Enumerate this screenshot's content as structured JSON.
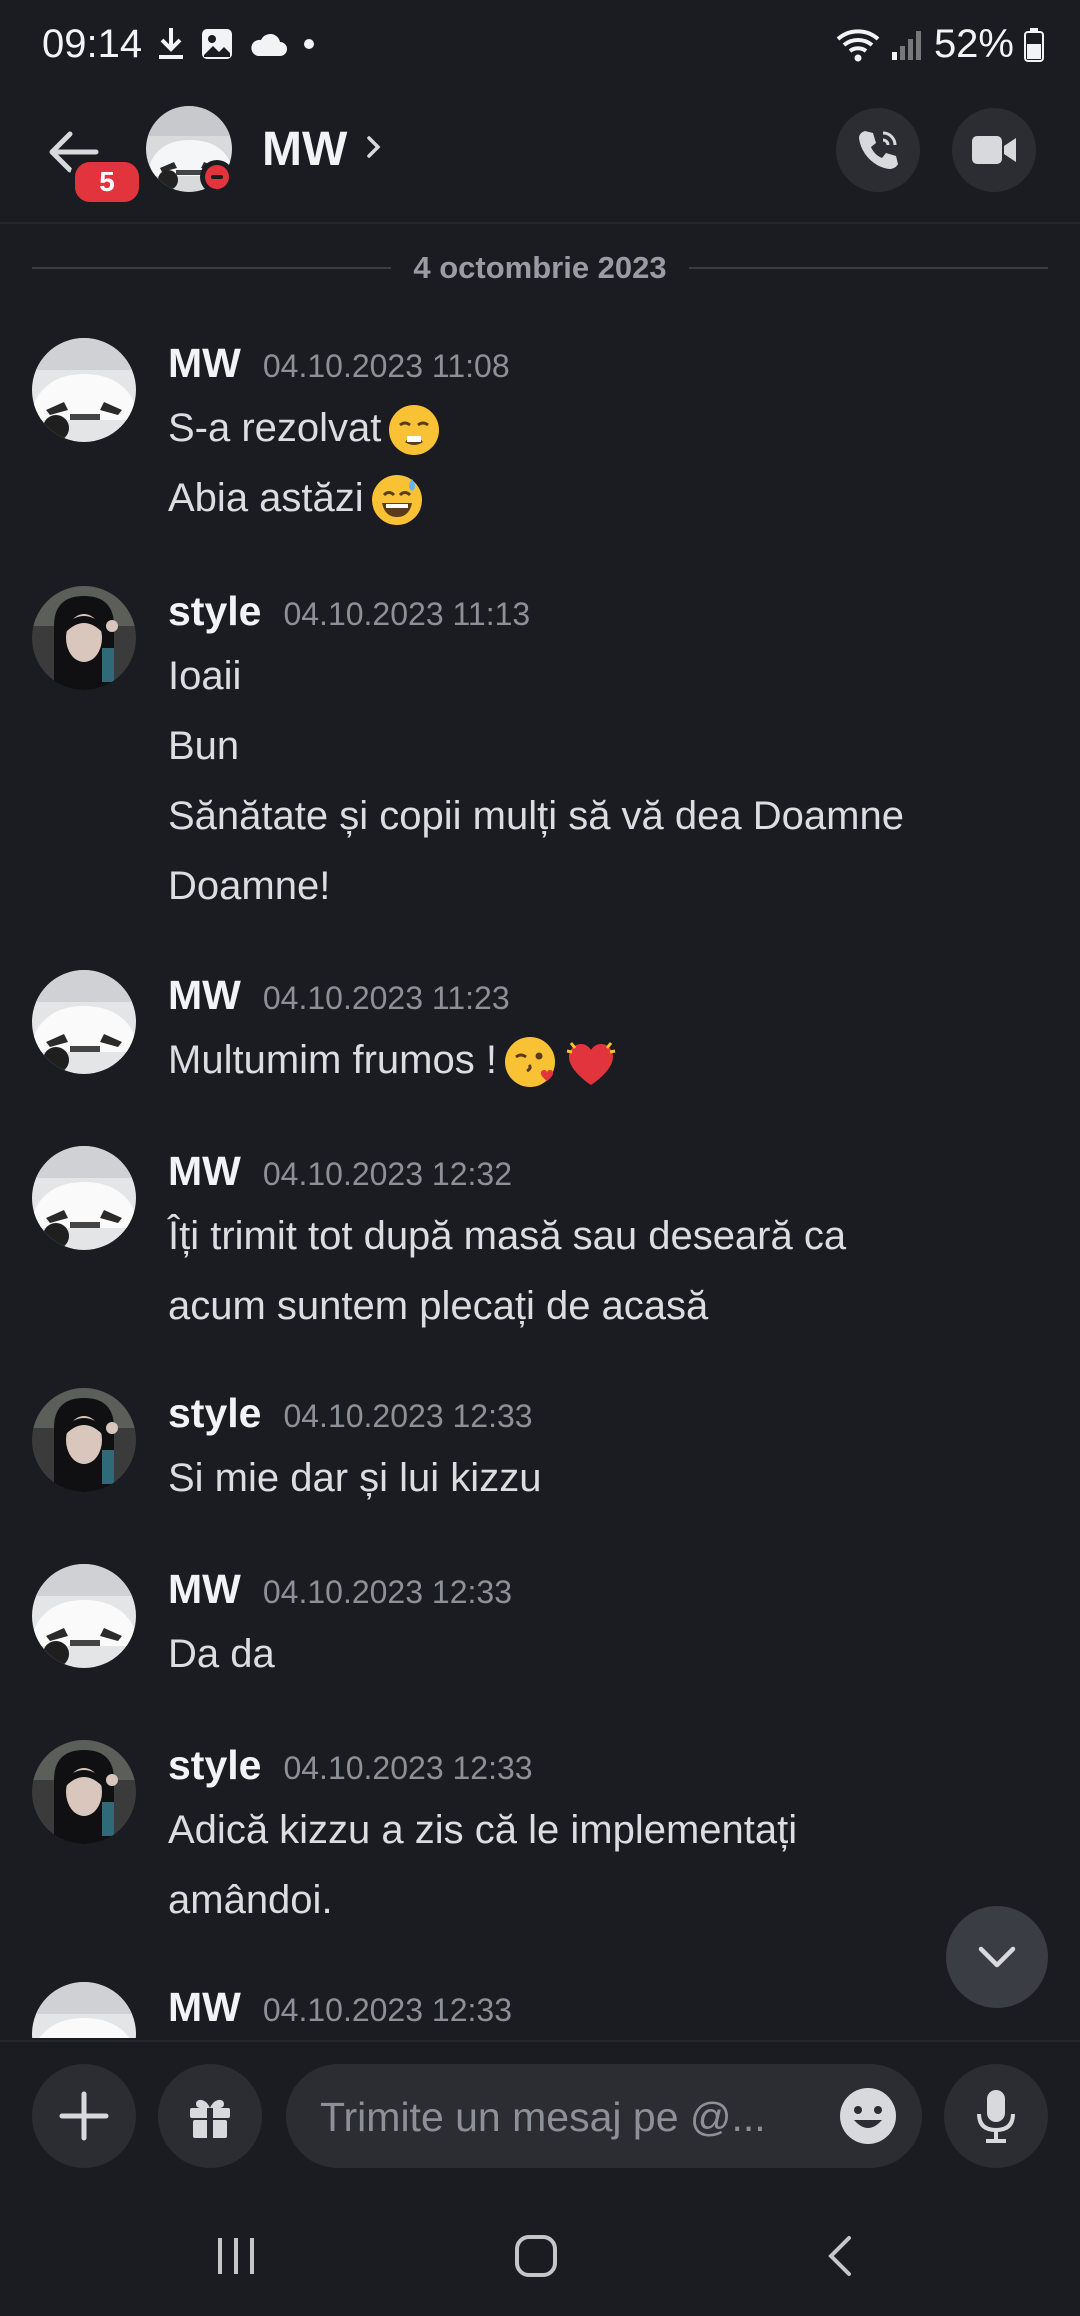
{
  "status_bar": {
    "time": "09:14",
    "battery": "52%"
  },
  "header": {
    "name": "MW",
    "unread_count": "5"
  },
  "date_divider": "4 octombrie 2023",
  "messages": [
    {
      "author": "MW",
      "timestamp": "04.10.2023 11:08",
      "lines": [
        "S-a rezolvat",
        "Abia astăzi"
      ]
    },
    {
      "author": "style",
      "timestamp": "04.10.2023 11:13",
      "lines": [
        "Ioaii",
        "Bun",
        "Sănătate și copii mulți să vă dea Doamne",
        "Doamne!"
      ]
    },
    {
      "author": "MW",
      "timestamp": "04.10.2023 11:23",
      "lines": [
        "Multumim frumos !"
      ]
    },
    {
      "author": "MW",
      "timestamp": "04.10.2023 12:32",
      "lines": [
        "Îți trimit tot după masă sau deseară ca",
        "acum suntem plecați de acasă"
      ]
    },
    {
      "author": "style",
      "timestamp": "04.10.2023 12:33",
      "lines": [
        "Si mie dar și lui kizzu"
      ]
    },
    {
      "author": "MW",
      "timestamp": "04.10.2023 12:33",
      "lines": [
        "Da da"
      ]
    },
    {
      "author": "style",
      "timestamp": "04.10.2023 12:33",
      "lines": [
        "Adică kizzu a zis că le implementați",
        "amândoi."
      ]
    },
    {
      "author": "MW",
      "timestamp": "04.10.2023 12:33",
      "lines": []
    }
  ],
  "composer": {
    "placeholder": "Trimite un mesaj pe @..."
  },
  "icons": {
    "back": "arrow-left-icon",
    "call": "phone-icon",
    "video": "video-camera-icon",
    "add": "plus-icon",
    "gift": "gift-icon",
    "emoji": "smiley-icon",
    "mic": "microphone-icon",
    "scroll": "chevron-down-icon"
  },
  "colors": {
    "background": "#1b1c21",
    "badge": "#e2343d",
    "surface": "#2b2d33"
  }
}
